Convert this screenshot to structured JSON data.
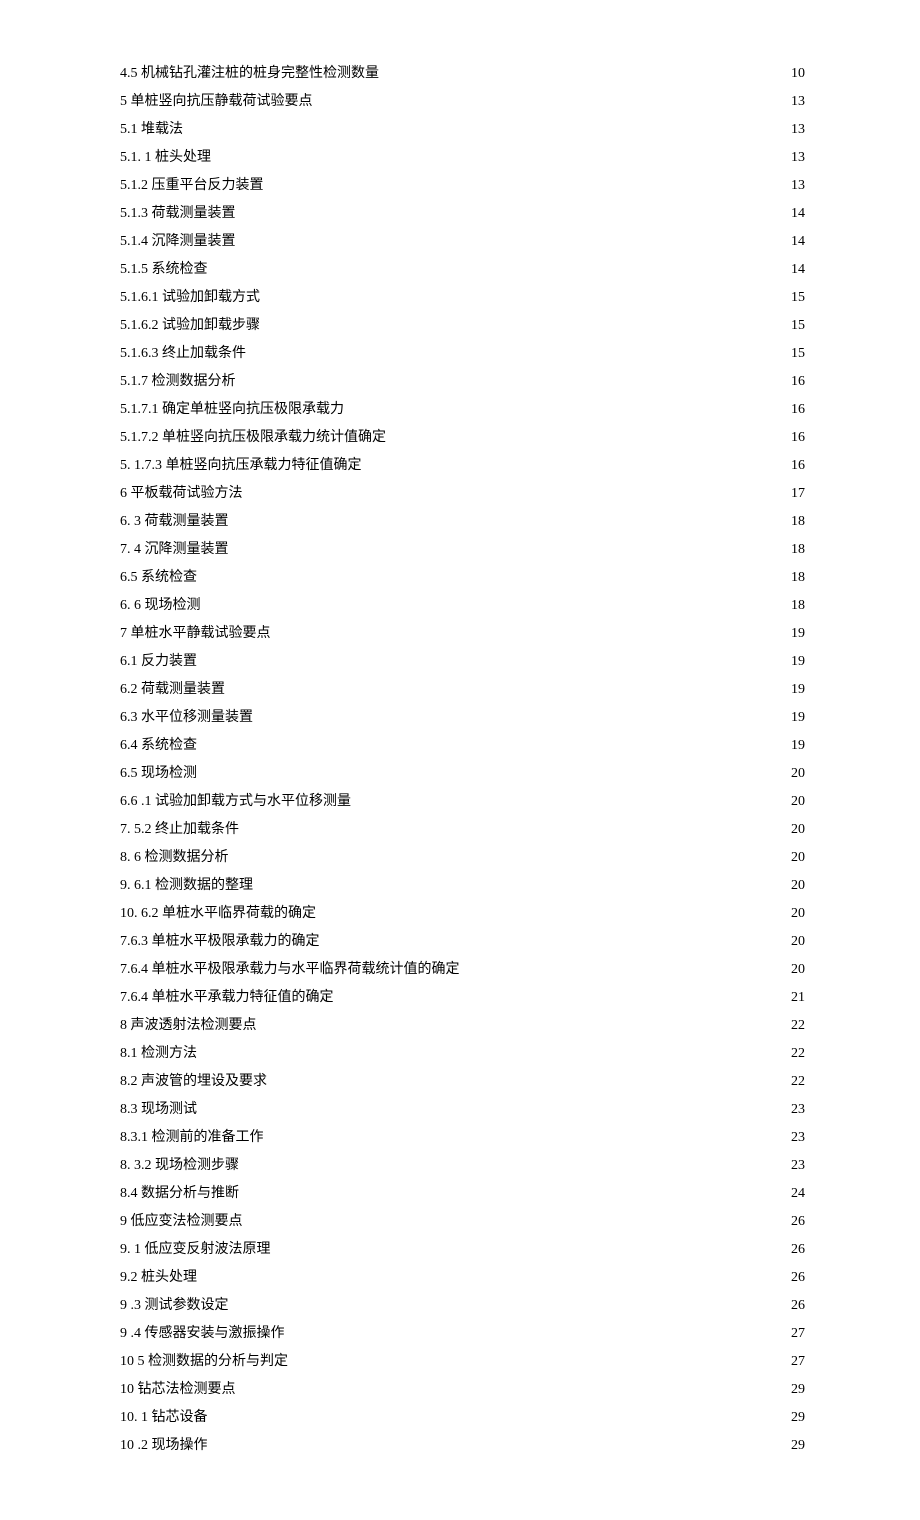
{
  "toc": [
    {
      "label": "4.5 机械钻孔灌注桩的桩身完整性检测数量",
      "page": "10"
    },
    {
      "label": "5 单桩竖向抗压静载荷试验要点",
      "page": "13"
    },
    {
      "label": "5.1 堆载法",
      "page": "13"
    },
    {
      "label": "5.1.   1 桩头处理",
      "page": "13"
    },
    {
      "label": "5.1.2      压重平台反力装置",
      "page": "13"
    },
    {
      "label": "5.1.3      荷载测量装置",
      "page": "14"
    },
    {
      "label": "5.1.4      沉降测量装置",
      "page": "14"
    },
    {
      "label": "5.1.5      系统检查",
      "page": "14"
    },
    {
      "label": "5.1.6.1      试验加卸载方式",
      "page": "15"
    },
    {
      "label": "5.1.6.2      试验加卸载步骤",
      "page": "15"
    },
    {
      "label": "5.1.6.3      终止加载条件",
      "page": "15"
    },
    {
      "label": "5.1.7 检测数据分析",
      "page": "16"
    },
    {
      "label": "5.1.7.1 确定单桩竖向抗压极限承载力",
      "page": "16"
    },
    {
      "label": "5.1.7.2 单桩竖向抗压极限承载力统计值确定",
      "page": "16"
    },
    {
      "label": "5.   1.7.3 单桩竖向抗压承载力特征值确定",
      "page": "16"
    },
    {
      "label": "6 平板载荷试验方法",
      "page": "17"
    },
    {
      "label": "6.   3 荷载测量装置",
      "page": "18"
    },
    {
      "label": "7.   4 沉降测量装置",
      "page": "18"
    },
    {
      "label": "6.5 系统检查",
      "page": "18"
    },
    {
      "label": "6.   6 现场检测",
      "page": "18"
    },
    {
      "label": "7 单桩水平静载试验要点",
      "page": "19"
    },
    {
      "label": "6.1      反力装置",
      "page": "19"
    },
    {
      "label": "6.2      荷载测量装置",
      "page": "19"
    },
    {
      "label": "6.3      水平位移测量装置",
      "page": "19"
    },
    {
      "label": "6.4      系统检查",
      "page": "19"
    },
    {
      "label": "6.5      现场检测",
      "page": "20"
    },
    {
      "label": "6.6      .1 试验加卸载方式与水平位移测量",
      "page": "20"
    },
    {
      "label": "7.   5.2 终止加载条件",
      "page": "20"
    },
    {
      "label": "8.   6 检测数据分析",
      "page": "20"
    },
    {
      "label": "9.   6.1 检测数据的整理",
      "page": "20"
    },
    {
      "label": "10. 6.2 单桩水平临界荷载的确定",
      "page": "20"
    },
    {
      "label": "7.6.3 单桩水平极限承载力的确定",
      "page": "20"
    },
    {
      "label": "7.6.4 单桩水平极限承载力与水平临界荷载统计值的确定",
      "page": "20"
    },
    {
      "label": "7.6.4 单桩水平承载力特征值的确定",
      "page": "21"
    },
    {
      "label": "8 声波透射法检测要点",
      "page": "22"
    },
    {
      "label": "8.1 检测方法",
      "page": "22"
    },
    {
      "label": "8.2 声波管的埋设及要求",
      "page": "22"
    },
    {
      "label": "8.3 现场测试",
      "page": "23"
    },
    {
      "label": "8.3.1 检测前的准备工作",
      "page": "23"
    },
    {
      "label": "8.   3.2 现场检测步骤",
      "page": "23"
    },
    {
      "label": "8.4 数据分析与推断",
      "page": "24"
    },
    {
      "label": "9 低应变法检测要点",
      "page": "26"
    },
    {
      "label": "9.   1 低应变反射波法原理",
      "page": "26"
    },
    {
      "label": "9.2 桩头处理",
      "page": "26"
    },
    {
      "label": "9    .3 测试参数设定",
      "page": "26"
    },
    {
      "label": "9    .4 传感器安装与激振操作",
      "page": "27"
    },
    {
      "label": "10   5 检测数据的分析与判定",
      "page": "27"
    },
    {
      "label": "10 钻芯法检测要点",
      "page": "29"
    },
    {
      "label": "10.   1 钻芯设备",
      "page": "29"
    },
    {
      "label": "10    .2 现场操作",
      "page": "29"
    }
  ]
}
